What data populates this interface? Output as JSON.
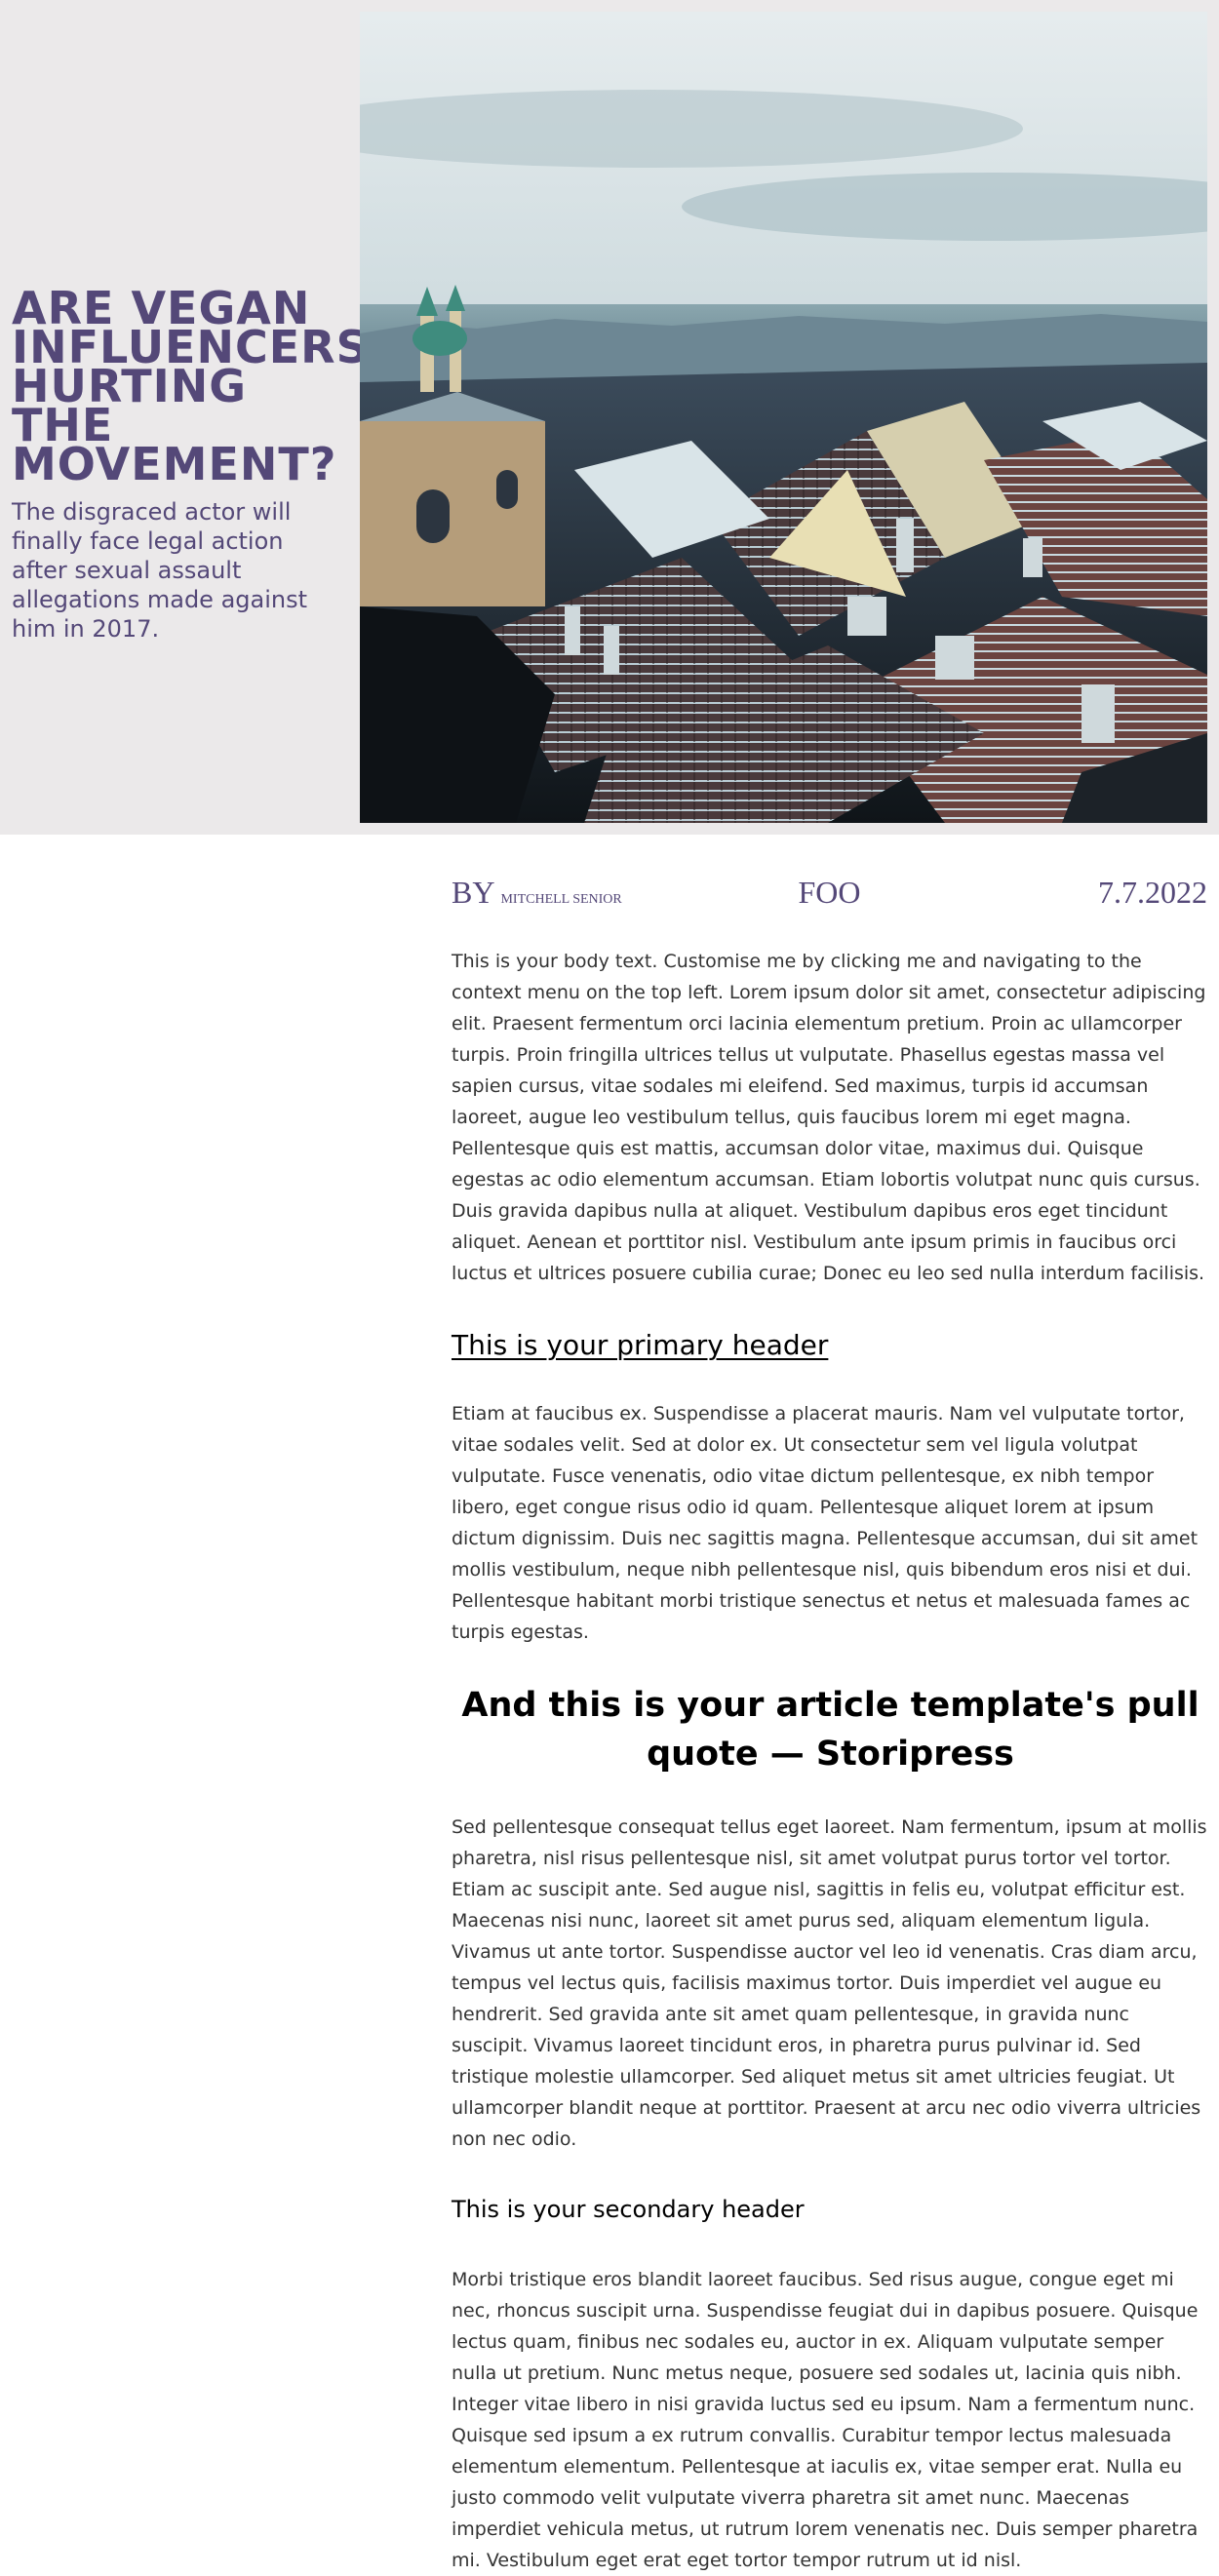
{
  "hero": {
    "title": "ARE VEGAN INFLUENCERS HURTING THE MOVEMENT?",
    "subtitle": "The disgraced actor will finally face legal action after sexual assault allegations made against him in 2017.",
    "image": "photo of snowy city rooftops under a cloudy sky",
    "background_color": "#ebe9ea",
    "accent_color": "#544878"
  },
  "meta": {
    "by_label": "BY",
    "author": "MITCHELL SENIOR",
    "section": "FOO",
    "date": "7.7.2022"
  },
  "article": {
    "paragraph_1": "This is your body text. Customise me by clicking me and navigating to the context menu on the top left. Lorem ipsum dolor sit amet, consectetur adipiscing elit. Praesent fermentum orci lacinia elementum pretium. Proin ac ullamcorper turpis. Proin fringilla ultrices tellus ut vulputate. Phasellus egestas massa vel sapien cursus, vitae sodales mi eleifend. Sed maximus, turpis id accumsan laoreet, augue leo vestibulum tellus, quis faucibus lorem mi eget magna. Pellentesque quis est mattis, accumsan dolor vitae, maximus dui. Quisque egestas ac odio elementum accumsan. Etiam lobortis volutpat nunc quis cursus. Duis gravida dapibus nulla at aliquet. Vestibulum dapibus eros eget tincidunt aliquet. Aenean et porttitor nisl. Vestibulum ante ipsum primis in faucibus orci luctus et ultrices posuere cubilia curae; Donec eu leo sed nulla interdum facilisis.",
    "primary_header": "This is your primary header",
    "paragraph_2": "Etiam at faucibus ex. Suspendisse a placerat mauris. Nam vel vulputate tortor, vitae sodales velit. Sed at dolor ex. Ut consectetur sem vel ligula volutpat vulputate. Fusce venenatis, odio vitae dictum pellentesque, ex nibh tempor libero, eget congue risus odio id quam. Pellentesque aliquet lorem at ipsum dictum dignissim. Duis nec sagittis magna. Pellentesque accumsan, dui sit amet mollis vestibulum, neque nibh pellentesque nisl, quis bibendum eros nisi et dui. Pellentesque habitant morbi tristique senectus et netus et malesuada fames ac turpis egestas.",
    "pull_quote": "And this is your article template's pull quote — Storipress",
    "paragraph_3": "Sed pellentesque consequat tellus eget laoreet. Nam fermentum, ipsum at mollis pharetra, nisl risus pellentesque nisl, sit amet volutpat purus tortor vel tortor. Etiam ac suscipit ante. Sed augue nisl, sagittis in felis eu, volutpat efficitur est. Maecenas nisi nunc, laoreet sit amet purus sed, aliquam elementum ligula. Vivamus ut ante tortor. Suspendisse auctor vel leo id venenatis. Cras diam arcu, tempus vel lectus quis, facilisis maximus tortor. Duis imperdiet vel augue eu hendrerit. Sed gravida ante sit amet quam pellentesque, in gravida nunc suscipit. Vivamus laoreet tincidunt eros, in pharetra purus pulvinar id. Sed tristique molestie ullamcorper. Sed aliquet metus sit amet ultricies feugiat. Ut ullamcorper blandit neque at porttitor. Praesent at arcu nec odio viverra ultricies non nec odio.",
    "secondary_header": "This is your secondary header",
    "paragraph_4": "Morbi tristique eros blandit laoreet faucibus. Sed risus augue, congue eget mi nec, rhoncus suscipit urna. Suspendisse feugiat dui in dapibus posuere. Quisque lectus quam, finibus nec sodales eu, auctor in ex. Aliquam vulputate semper nulla ut pretium. Nunc metus neque, posuere sed sodales ut, lacinia quis nibh. Integer vitae libero in nisi gravida luctus sed eu ipsum. Nam a fermentum nunc. Quisque sed ipsum a ex rutrum convallis. Curabitur tempor lectus malesuada elementum elementum. Pellentesque at iaculis ex, vitae semper erat. Nulla eu justo commodo velit vulputate viverra pharetra sit amet nunc. Maecenas imperdiet vehicula metus, ut rutrum lorem venenatis nec. Duis semper pharetra mi. Vestibulum eget erat eget tortor tempor rutrum ut id nisl."
  }
}
